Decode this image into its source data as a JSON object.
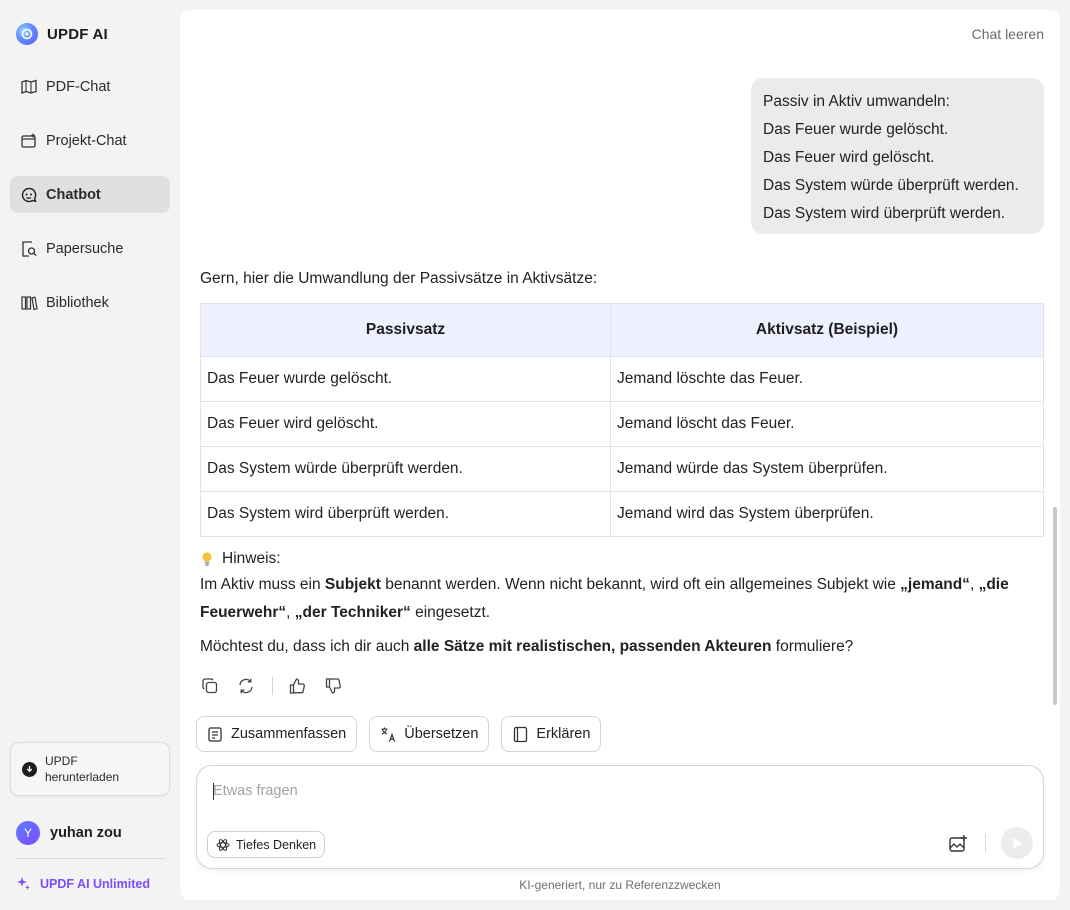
{
  "app": {
    "title": "UPDF AI"
  },
  "sidebar": {
    "items": [
      {
        "label": "PDF-Chat",
        "icon": "pdf-chat-icon"
      },
      {
        "label": "Projekt-Chat",
        "icon": "project-chat-icon"
      },
      {
        "label": "Chatbot",
        "icon": "chatbot-icon",
        "active": true
      },
      {
        "label": "Papersuche",
        "icon": "paper-search-icon"
      },
      {
        "label": "Bibliothek",
        "icon": "library-icon"
      }
    ],
    "download": {
      "label": "UPDF herunterladen"
    },
    "user": {
      "initial": "Y",
      "name": "yuhan zou"
    },
    "unlimited": "UPDF AI Unlimited"
  },
  "chat": {
    "clear_label": "Chat leeren",
    "user_message": [
      "Passiv in Aktiv umwandeln:",
      "Das Feuer wurde gelöscht.",
      "Das Feuer wird gelöscht.",
      "Das System würde überprüft werden.",
      "Das System wird überprüft werden."
    ],
    "answer": {
      "intro": "Gern, hier die Umwandlung der Passivsätze in Aktivsätze:",
      "table": {
        "headers": [
          "Passivsatz",
          "Aktivsatz (Beispiel)"
        ],
        "rows": [
          [
            "Das Feuer wurde gelöscht.",
            "Jemand löschte das Feuer."
          ],
          [
            "Das Feuer wird gelöscht.",
            "Jemand löscht das Feuer."
          ],
          [
            "Das System würde überprüft werden.",
            "Jemand würde das System überprüfen."
          ],
          [
            "Das System wird überprüft werden.",
            "Jemand wird das System überprüfen."
          ]
        ]
      },
      "hint_title": "Hinweis:",
      "hint": {
        "t1": "Im Aktiv muss ein ",
        "b1": "Subjekt",
        "t2": " benannt werden. Wenn nicht bekannt, wird oft ein allgemeines Subjekt wie ",
        "b2": "„jemand“",
        "t3": ", ",
        "b3": "„die Feuerwehr“",
        "t4": ", ",
        "b4": "„der Techniker“",
        "t5": " eingesetzt."
      },
      "question": {
        "t1": "Möchtest du, dass ich dir auch ",
        "b1": "alle Sätze mit realistischen, passenden Akteuren",
        "t2": " formuliere?"
      }
    },
    "chips": [
      "Zusammenfassen",
      "Übersetzen",
      "Erklären"
    ],
    "input": {
      "placeholder": "Etwas fragen",
      "value": ""
    },
    "deep_think_label": "Tiefes Denken",
    "footnote": "KI-generiert, nur zu Referenzzwecken"
  },
  "colors": {
    "accent": "#7a4dff",
    "table_header_bg": "#eef0fd",
    "active_nav_bg": "#e0e0e2"
  }
}
